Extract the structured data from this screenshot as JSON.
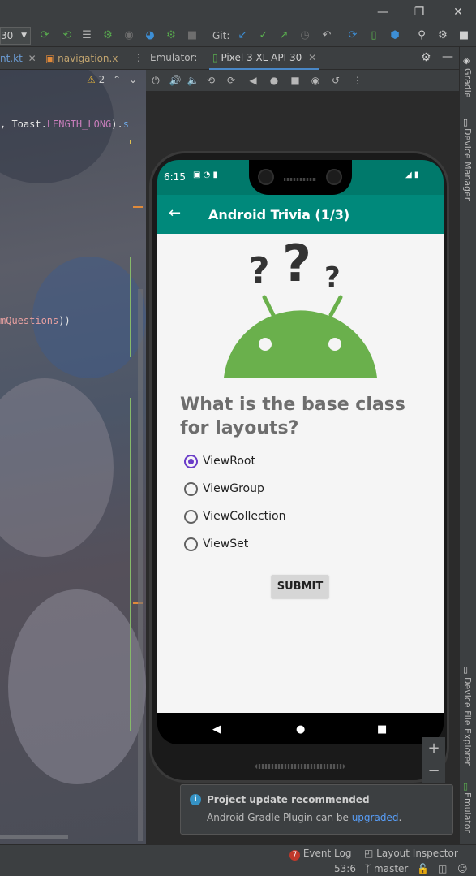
{
  "toolbar": {
    "config_value": "30",
    "git_label": "Git:"
  },
  "editor": {
    "tabs": [
      {
        "label": "nt.kt"
      },
      {
        "label": "navigation.x"
      }
    ],
    "warning_count": "2",
    "code_lines": [
      {
        "parts": [
          ", ",
          "Toast",
          ".",
          "LENGTH_LONG",
          ").",
          "s"
        ]
      },
      {
        "parts": [
          "mQuestions",
          "))"
        ]
      }
    ]
  },
  "emulator": {
    "label": "Emulator:",
    "device_tab": "Pixel 3 XL API 30"
  },
  "right_strip": {
    "items": [
      "Gradle",
      "Device Manager",
      "Device File Explorer",
      "Emulator"
    ]
  },
  "phone": {
    "status_time": "6:15",
    "app_title": "Android Trivia (1/3)",
    "question": "What is the base class for layouts?",
    "options": [
      {
        "label": "ViewRoot",
        "checked": true
      },
      {
        "label": "ViewGroup",
        "checked": false
      },
      {
        "label": "ViewCollection",
        "checked": false
      },
      {
        "label": "ViewSet",
        "checked": false
      }
    ],
    "submit_label": "SUBMIT"
  },
  "notification": {
    "title": "Project update recommended",
    "text_prefix": "Android Gradle Plugin can be ",
    "link": "upgraded",
    "text_suffix": "."
  },
  "bottom_bar": {
    "event_log_count": "7",
    "event_log": "Event Log",
    "layout_inspector": "Layout Inspector"
  },
  "status_bar": {
    "position": "53:6",
    "branch": "master"
  },
  "colors": {
    "accent_teal": "#00897b",
    "status_teal": "#00796b",
    "android_green": "#6ab04c",
    "radio_purple": "#6a3cc8"
  }
}
